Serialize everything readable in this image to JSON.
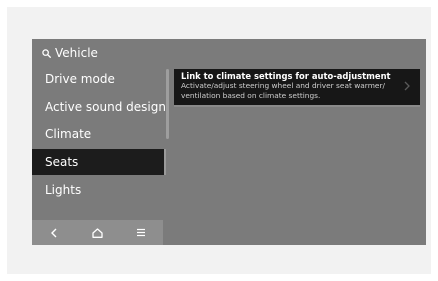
{
  "header": {
    "search_label": "Vehicle",
    "search_icon": "search-icon"
  },
  "menu": {
    "items": [
      {
        "label": "Drive mode",
        "active": false
      },
      {
        "label": "Active sound design",
        "active": false
      },
      {
        "label": "Climate",
        "active": false
      },
      {
        "label": "Seats",
        "active": true
      },
      {
        "label": "Lights",
        "active": false
      }
    ]
  },
  "bottom_bar": {
    "icons": [
      "back-icon",
      "home-icon",
      "menu-icon"
    ]
  },
  "popup": {
    "title": "Link to climate settings for auto-adjustment",
    "description": "Activate/adjust steering wheel and driver seat warmer/ ventilation based on climate settings.",
    "icon": "chevron-right-icon"
  },
  "colors": {
    "screen_bg": "#7b7b7b",
    "active_bg": "#1c1c1c",
    "card_bg": "#171717",
    "text": "#ffffff"
  }
}
